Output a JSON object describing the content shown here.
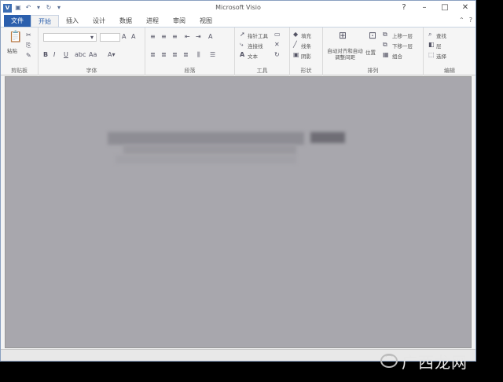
{
  "window": {
    "title": "Microsoft Visio"
  },
  "quick_access": {
    "icons": [
      "save-icon",
      "undo-icon",
      "redo-icon",
      "customize-icon"
    ]
  },
  "window_controls": {
    "help": "?",
    "minimize": "–",
    "restore": "□",
    "close": "✕"
  },
  "tabs": [
    {
      "label": "文件",
      "type": "file"
    },
    {
      "label": "开始",
      "active": true
    },
    {
      "label": "插入"
    },
    {
      "label": "设计"
    },
    {
      "label": "数据"
    },
    {
      "label": "进程"
    },
    {
      "label": "审阅"
    },
    {
      "label": "视图"
    }
  ],
  "ribbon": {
    "groups": [
      {
        "label": "剪贴板"
      },
      {
        "label": "字体"
      },
      {
        "label": "段落"
      },
      {
        "label": "工具"
      },
      {
        "label": "形状"
      },
      {
        "label": "排列"
      },
      {
        "label": "编辑"
      }
    ],
    "clipboard": {
      "paste_label": "粘贴"
    },
    "tools": {
      "pointer_label": "指针工具",
      "connector_label": "连接线",
      "text_label": "文本"
    },
    "shape": {
      "fill_label": "填充",
      "line_label": "线条",
      "shadow_label": "阴影"
    },
    "arrange": {
      "auto_align_label": "自动对齐和自动调整间距",
      "position_label": "位置",
      "bring_forward_label": "上移一层",
      "send_backward_label": "下移一层",
      "group_label": "组合"
    },
    "editing": {
      "find_label": "查找",
      "layers_label": "层",
      "select_label": "选择"
    }
  },
  "colors": {
    "file_tab": "#2b5fad",
    "canvas": "#a8a7ad",
    "ribbon": "#f5f5f5"
  },
  "watermark": {
    "text": "广西龙网"
  }
}
